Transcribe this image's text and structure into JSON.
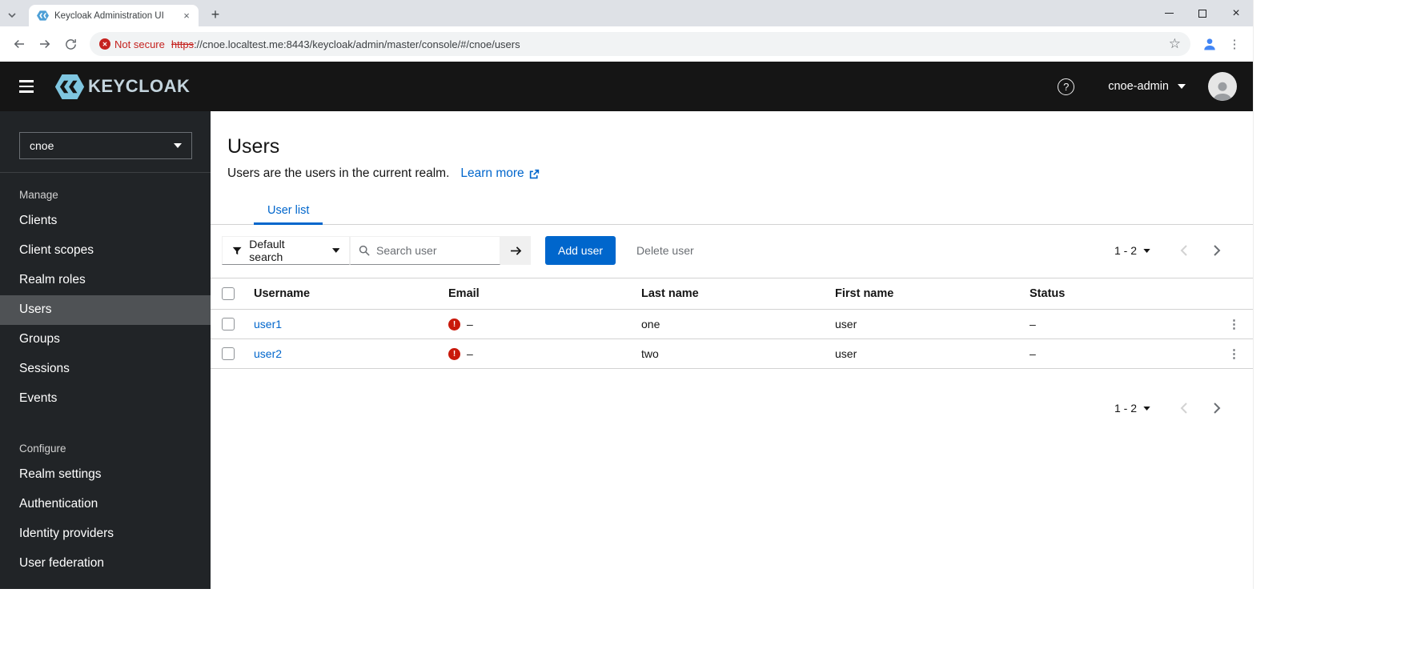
{
  "colors": {
    "accent": "#0066cc",
    "link": "#0066cc",
    "danger": "#c9190b",
    "not_secure_red": "#c5221f",
    "masthead_bg": "#151515",
    "sidebar_bg": "#212427",
    "sidebar_active_bg": "#4f5255"
  },
  "icons": {
    "tab_close": "×",
    "new_tab": "+",
    "window_close": "×",
    "not_secure_x": "✕",
    "star": "☆",
    "browser_kebab": "⋮",
    "help": "?",
    "error": "!",
    "row_kebab": "⋮"
  },
  "browser": {
    "tab_title": "Keycloak Administration UI",
    "not_secure": "Not secure",
    "url_scheme": "https",
    "url_rest": "://cnoe.localtest.me:8443/keycloak/admin/master/console/#/cnoe/users"
  },
  "masthead": {
    "brand": "KEYCLOAK",
    "username": "cnoe-admin"
  },
  "sidebar": {
    "realm": "cnoe",
    "sections": [
      {
        "label": "Manage",
        "items": [
          {
            "label": "Clients",
            "active": false
          },
          {
            "label": "Client scopes",
            "active": false
          },
          {
            "label": "Realm roles",
            "active": false
          },
          {
            "label": "Users",
            "active": true
          },
          {
            "label": "Groups",
            "active": false
          },
          {
            "label": "Sessions",
            "active": false
          },
          {
            "label": "Events",
            "active": false
          }
        ]
      },
      {
        "label": "Configure",
        "items": [
          {
            "label": "Realm settings",
            "active": false
          },
          {
            "label": "Authentication",
            "active": false
          },
          {
            "label": "Identity providers",
            "active": false
          },
          {
            "label": "User federation",
            "active": false
          }
        ]
      }
    ]
  },
  "main": {
    "title": "Users",
    "subtitle": "Users are the users in the current realm.",
    "learn_more": "Learn more",
    "tab_label": "User list",
    "toolbar": {
      "filter_label": "Default search",
      "search_placeholder": "Search user",
      "add_user_label": "Add user",
      "delete_user_label": "Delete user"
    },
    "pagination": {
      "range": "1 - 2"
    },
    "table": {
      "headers": [
        "Username",
        "Email",
        "Last name",
        "First name",
        "Status"
      ],
      "rows": [
        {
          "username": "user1",
          "email": "–",
          "last_name": "one",
          "first_name": "user",
          "status": "–"
        },
        {
          "username": "user2",
          "email": "–",
          "last_name": "two",
          "first_name": "user",
          "status": "–"
        }
      ]
    }
  }
}
